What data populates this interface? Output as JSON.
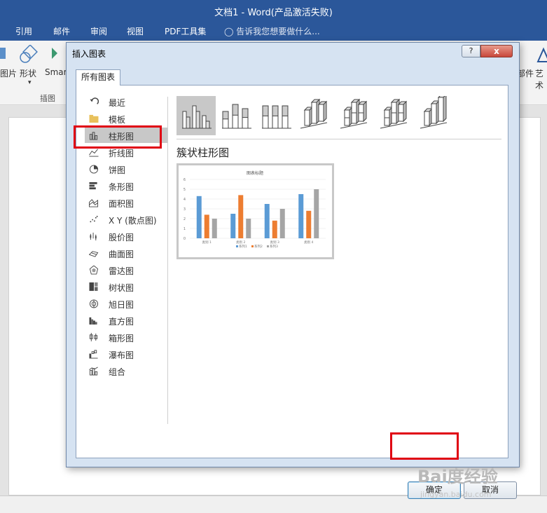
{
  "window": {
    "title": "文档1 - Word(产品激活失败)"
  },
  "ribbon_tabs": [
    "引用",
    "邮件",
    "审阅",
    "视图",
    "PDF工具集"
  ],
  "tell_me": "告诉我您想要做什么...",
  "ribbon": {
    "left_labels": [
      "图片",
      "形状",
      "Smar"
    ],
    "group_label": "插图",
    "right_labels": [
      "部件",
      "艺术"
    ]
  },
  "dialog": {
    "title": "插入图表",
    "help": "?",
    "close": "x",
    "tab": "所有图表",
    "categories": [
      {
        "label": "最近",
        "icon": "recent-icon"
      },
      {
        "label": "模板",
        "icon": "folder-icon"
      },
      {
        "label": "柱形图",
        "icon": "column-chart-icon",
        "selected": true
      },
      {
        "label": "折线图",
        "icon": "line-chart-icon"
      },
      {
        "label": "饼图",
        "icon": "pie-chart-icon"
      },
      {
        "label": "条形图",
        "icon": "bar-chart-icon"
      },
      {
        "label": "面积图",
        "icon": "area-chart-icon"
      },
      {
        "label": "X Y (散点图)",
        "icon": "scatter-chart-icon"
      },
      {
        "label": "股价图",
        "icon": "stock-chart-icon"
      },
      {
        "label": "曲面图",
        "icon": "surface-chart-icon"
      },
      {
        "label": "雷达图",
        "icon": "radar-chart-icon"
      },
      {
        "label": "树状图",
        "icon": "treemap-chart-icon"
      },
      {
        "label": "旭日图",
        "icon": "sunburst-chart-icon"
      },
      {
        "label": "直方图",
        "icon": "histogram-chart-icon"
      },
      {
        "label": "箱形图",
        "icon": "box-whisker-chart-icon"
      },
      {
        "label": "瀑布图",
        "icon": "waterfall-chart-icon"
      },
      {
        "label": "组合",
        "icon": "combo-chart-icon"
      }
    ],
    "subtype_count": 7,
    "selected_subtype": "簇状柱形图",
    "ok": "确定",
    "cancel": "取消"
  },
  "preview": {
    "chart_data": {
      "type": "bar",
      "title": "图表标题",
      "categories": [
        "类别 1",
        "类别 2",
        "类别 3",
        "类别 4"
      ],
      "series": [
        {
          "name": "系列1",
          "values": [
            4.3,
            2.5,
            3.5,
            4.5
          ],
          "color": "#5b9bd5"
        },
        {
          "name": "系列2",
          "values": [
            2.4,
            4.4,
            1.8,
            2.8
          ],
          "color": "#ed7d31"
        },
        {
          "name": "系列3",
          "values": [
            2,
            2,
            3,
            5
          ],
          "color": "#a5a5a5"
        }
      ],
      "ylim": [
        0,
        6
      ],
      "yticks": [
        0,
        1,
        2,
        3,
        4,
        5,
        6
      ],
      "grid": true,
      "legend": "bottom"
    }
  },
  "watermark": {
    "text": "Bai度经验",
    "sub": "jingyan.baidu.com"
  }
}
